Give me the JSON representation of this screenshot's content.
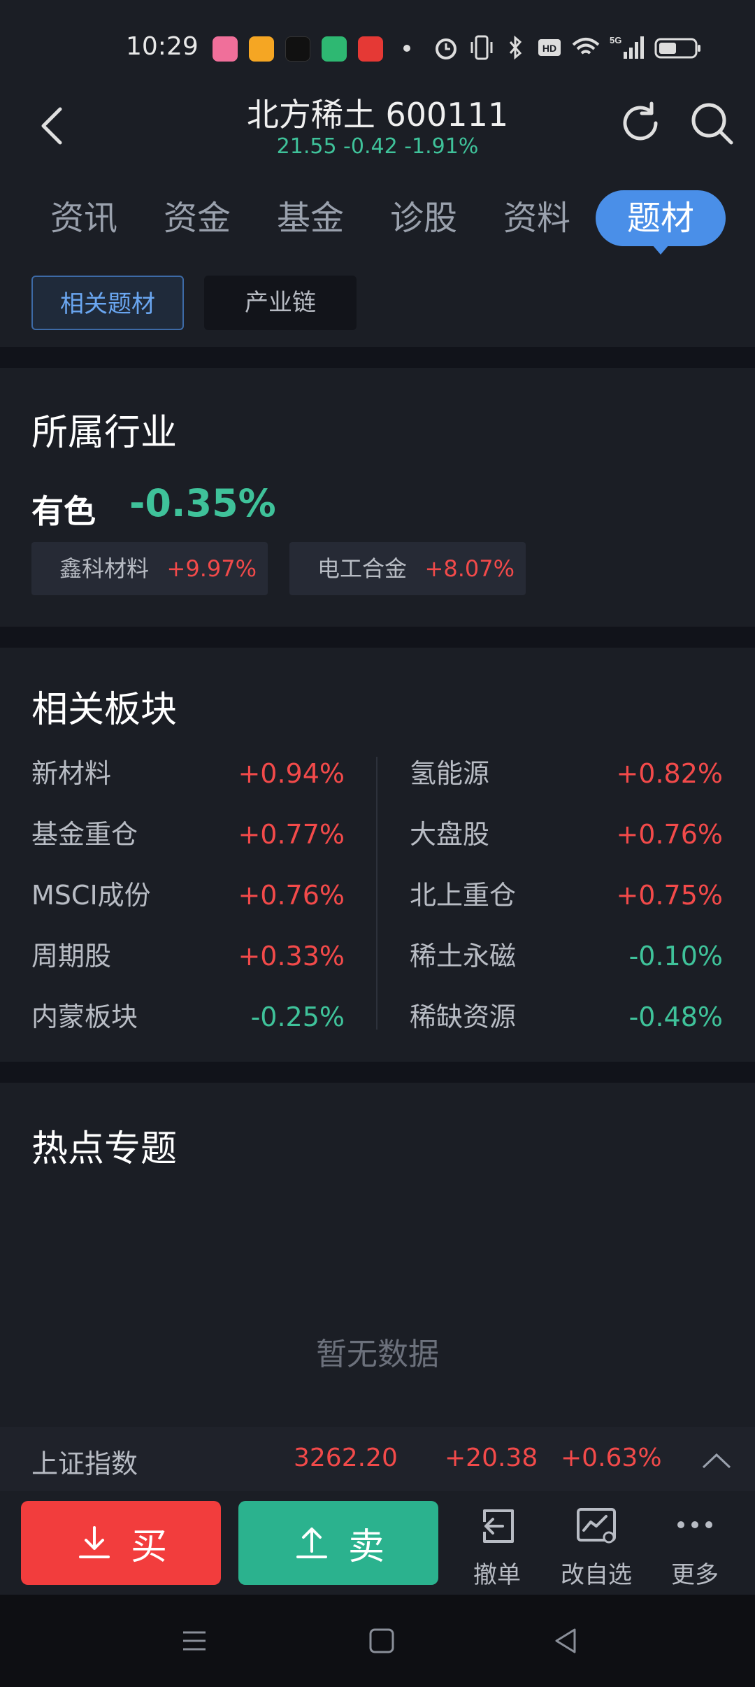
{
  "status_bar": {
    "time": "10:29"
  },
  "header": {
    "title": "北方稀土 600111",
    "quote": "21.55 -0.42 -1.91%"
  },
  "tabs": [
    {
      "label": "资讯",
      "active": false
    },
    {
      "label": "资金",
      "active": false
    },
    {
      "label": "基金",
      "active": false
    },
    {
      "label": "诊股",
      "active": false
    },
    {
      "label": "资料",
      "active": false
    },
    {
      "label": "题材",
      "active": true
    }
  ],
  "subtabs": {
    "related": "相关题材",
    "chain": "产业链"
  },
  "industry": {
    "title": "所属行业",
    "name": "有色",
    "change": "-0.35%",
    "chips": [
      {
        "name": "鑫科材料",
        "change": "+9.97%"
      },
      {
        "name": "电工合金",
        "change": "+8.07%"
      }
    ]
  },
  "sectors": {
    "title": "相关板块",
    "left": [
      {
        "name": "新材料",
        "change": "+0.94%",
        "dir": "up"
      },
      {
        "name": "基金重仓",
        "change": "+0.77%",
        "dir": "up"
      },
      {
        "name": "MSCI成份",
        "change": "+0.76%",
        "dir": "up"
      },
      {
        "name": "周期股",
        "change": "+0.33%",
        "dir": "up"
      },
      {
        "name": "内蒙板块",
        "change": "-0.25%",
        "dir": "down"
      }
    ],
    "right": [
      {
        "name": "氢能源",
        "change": "+0.82%",
        "dir": "up"
      },
      {
        "name": "大盘股",
        "change": "+0.76%",
        "dir": "up"
      },
      {
        "name": "北上重仓",
        "change": "+0.75%",
        "dir": "up"
      },
      {
        "name": "稀土永磁",
        "change": "-0.10%",
        "dir": "down"
      },
      {
        "name": "稀缺资源",
        "change": "-0.48%",
        "dir": "down"
      }
    ]
  },
  "hot_topics": {
    "title": "热点专题",
    "empty": "暂无数据"
  },
  "index_bar": {
    "name": "上证指数",
    "value": "3262.20",
    "change": "+20.38",
    "pct": "+0.63%"
  },
  "actions": {
    "buy": "买",
    "sell": "卖",
    "cancel": "撤单",
    "edit_watchlist": "改自选",
    "more": "更多"
  },
  "colors": {
    "up": "#f24a4a",
    "down": "#3fc29a",
    "accent": "#4a8fe8"
  }
}
